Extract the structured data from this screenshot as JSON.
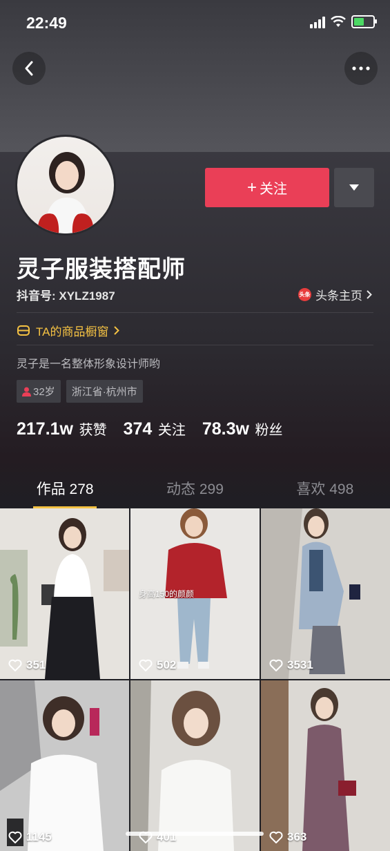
{
  "status": {
    "time": "22:49"
  },
  "profile": {
    "name": "灵子服装搭配师",
    "douyin_id": "抖音号: XYLZ1987",
    "toutiao_logo": "头条",
    "toutiao_link": "头条主页",
    "shop_link": "TA的商品橱窗",
    "bio": "灵子是一名整体形象设计师哟",
    "age_tag": "32岁",
    "location_tag": "浙江省·杭州市",
    "follow_label": "关注",
    "stats": [
      {
        "num": "217.1w",
        "label": "获赞"
      },
      {
        "num": "374",
        "label": "关注"
      },
      {
        "num": "78.3w",
        "label": "粉丝"
      }
    ]
  },
  "tabs": [
    {
      "label": "作品 278",
      "active": true
    },
    {
      "label": "动态 299",
      "active": false
    },
    {
      "label": "喜欢 498",
      "active": false
    }
  ],
  "videos": [
    {
      "likes": "351",
      "overlay": ""
    },
    {
      "likes": "502",
      "overlay": "身高150的颜颜"
    },
    {
      "likes": "3531",
      "overlay": ""
    },
    {
      "likes": "1145",
      "overlay": ""
    },
    {
      "likes": "401",
      "overlay": ""
    },
    {
      "likes": "363",
      "overlay": ""
    }
  ],
  "colors": {
    "accent": "#ea3f57",
    "gold": "#f5c243",
    "bg": "#1f1f24"
  }
}
